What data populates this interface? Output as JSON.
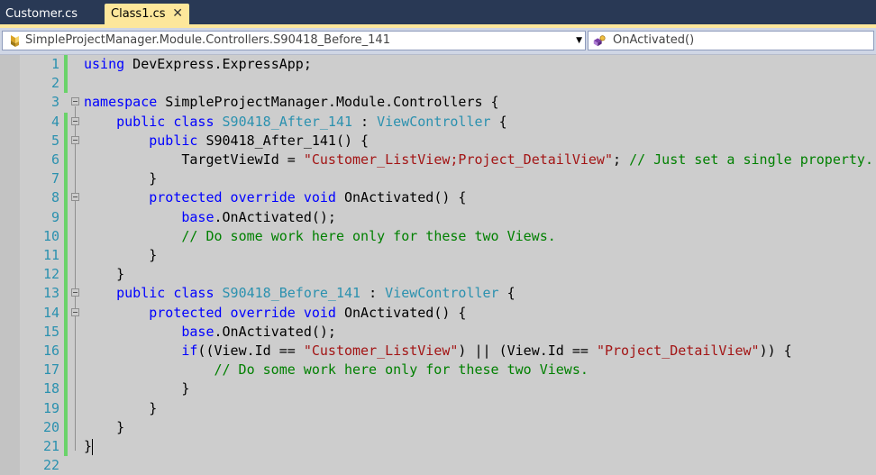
{
  "tabs": [
    {
      "label": "Customer.cs",
      "active": false
    },
    {
      "label": "Class1.cs",
      "active": true,
      "close_icon": "close-icon"
    }
  ],
  "navigation": {
    "type_combo": {
      "value": "SimpleProjectManager.Module.Controllers.S90418_Before_141",
      "icon": "class-icon"
    },
    "member_combo": {
      "value": "OnActivated()",
      "icon": "method-icon"
    }
  },
  "editor": {
    "colors": {
      "keyword": "#0000ff",
      "type": "#2b91af",
      "string": "#a31515",
      "comment": "#008000",
      "line_number": "#2b91af",
      "change_bar": "#6ad36a",
      "background": "#cdcdcd"
    },
    "lines": [
      {
        "num": "1",
        "changed": true,
        "fold": false,
        "indent": 0,
        "tokens": [
          [
            "keyword",
            "using"
          ],
          [
            "plain",
            " DevExpress.ExpressApp;"
          ]
        ]
      },
      {
        "num": "2",
        "changed": true,
        "fold": false,
        "indent": 0,
        "tokens": []
      },
      {
        "num": "3",
        "changed": false,
        "fold": true,
        "indent": 0,
        "tokens": [
          [
            "keyword",
            "namespace"
          ],
          [
            "plain",
            " SimpleProjectManager.Module.Controllers {"
          ]
        ]
      },
      {
        "num": "4",
        "changed": true,
        "fold": true,
        "indent": 1,
        "tokens": [
          [
            "keyword",
            "public"
          ],
          [
            "plain",
            " "
          ],
          [
            "keyword",
            "class"
          ],
          [
            "plain",
            " "
          ],
          [
            "type",
            "S90418_After_141"
          ],
          [
            "plain",
            " : "
          ],
          [
            "type",
            "ViewController"
          ],
          [
            "plain",
            " {"
          ]
        ]
      },
      {
        "num": "5",
        "changed": true,
        "fold": true,
        "indent": 2,
        "tokens": [
          [
            "keyword",
            "public"
          ],
          [
            "plain",
            " S90418_After_141() {"
          ]
        ]
      },
      {
        "num": "6",
        "changed": true,
        "fold": false,
        "indent": 3,
        "tokens": [
          [
            "plain",
            "TargetViewId = "
          ],
          [
            "string",
            "\"Customer_ListView;Project_DetailView\""
          ],
          [
            "plain",
            "; "
          ],
          [
            "comment",
            "// Just set a single property."
          ]
        ]
      },
      {
        "num": "7",
        "changed": true,
        "fold": false,
        "indent": 2,
        "tokens": [
          [
            "plain",
            "}"
          ]
        ]
      },
      {
        "num": "8",
        "changed": true,
        "fold": true,
        "indent": 2,
        "tokens": [
          [
            "keyword",
            "protected"
          ],
          [
            "plain",
            " "
          ],
          [
            "keyword",
            "override"
          ],
          [
            "plain",
            " "
          ],
          [
            "keyword",
            "void"
          ],
          [
            "plain",
            " OnActivated() {"
          ]
        ]
      },
      {
        "num": "9",
        "changed": true,
        "fold": false,
        "indent": 3,
        "tokens": [
          [
            "keyword",
            "base"
          ],
          [
            "plain",
            ".OnActivated();"
          ]
        ]
      },
      {
        "num": "10",
        "changed": true,
        "fold": false,
        "indent": 3,
        "tokens": [
          [
            "comment",
            "// Do some work here only for these two Views."
          ]
        ]
      },
      {
        "num": "11",
        "changed": true,
        "fold": false,
        "indent": 2,
        "tokens": [
          [
            "plain",
            "}"
          ]
        ]
      },
      {
        "num": "12",
        "changed": true,
        "fold": false,
        "indent": 1,
        "tokens": [
          [
            "plain",
            "}"
          ]
        ]
      },
      {
        "num": "13",
        "changed": true,
        "fold": true,
        "indent": 1,
        "tokens": [
          [
            "keyword",
            "public"
          ],
          [
            "plain",
            " "
          ],
          [
            "keyword",
            "class"
          ],
          [
            "plain",
            " "
          ],
          [
            "type",
            "S90418_Before_141"
          ],
          [
            "plain",
            " : "
          ],
          [
            "type",
            "ViewController"
          ],
          [
            "plain",
            " {"
          ]
        ]
      },
      {
        "num": "14",
        "changed": true,
        "fold": true,
        "indent": 2,
        "tokens": [
          [
            "keyword",
            "protected"
          ],
          [
            "plain",
            " "
          ],
          [
            "keyword",
            "override"
          ],
          [
            "plain",
            " "
          ],
          [
            "keyword",
            "void"
          ],
          [
            "plain",
            " OnActivated() {"
          ]
        ]
      },
      {
        "num": "15",
        "changed": true,
        "fold": false,
        "indent": 3,
        "tokens": [
          [
            "keyword",
            "base"
          ],
          [
            "plain",
            ".OnActivated();"
          ]
        ]
      },
      {
        "num": "16",
        "changed": true,
        "fold": false,
        "indent": 3,
        "tokens": [
          [
            "keyword",
            "if"
          ],
          [
            "plain",
            "((View.Id == "
          ],
          [
            "string",
            "\"Customer_ListView\""
          ],
          [
            "plain",
            ") || (View.Id == "
          ],
          [
            "string",
            "\"Project_DetailView\""
          ],
          [
            "plain",
            ")) {"
          ]
        ]
      },
      {
        "num": "17",
        "changed": true,
        "fold": false,
        "indent": 4,
        "tokens": [
          [
            "comment",
            "// Do some work here only for these two Views."
          ]
        ]
      },
      {
        "num": "18",
        "changed": true,
        "fold": false,
        "indent": 3,
        "tokens": [
          [
            "plain",
            "}"
          ]
        ]
      },
      {
        "num": "19",
        "changed": true,
        "fold": false,
        "indent": 2,
        "tokens": [
          [
            "plain",
            "}"
          ]
        ]
      },
      {
        "num": "20",
        "changed": true,
        "fold": false,
        "indent": 1,
        "tokens": [
          [
            "plain",
            "}"
          ]
        ]
      },
      {
        "num": "21",
        "changed": true,
        "fold": false,
        "indent": 0,
        "tokens": [
          [
            "plain",
            "}"
          ]
        ],
        "caret": true
      },
      {
        "num": "22",
        "changed": false,
        "fold": false,
        "indent": 0,
        "tokens": []
      }
    ]
  }
}
